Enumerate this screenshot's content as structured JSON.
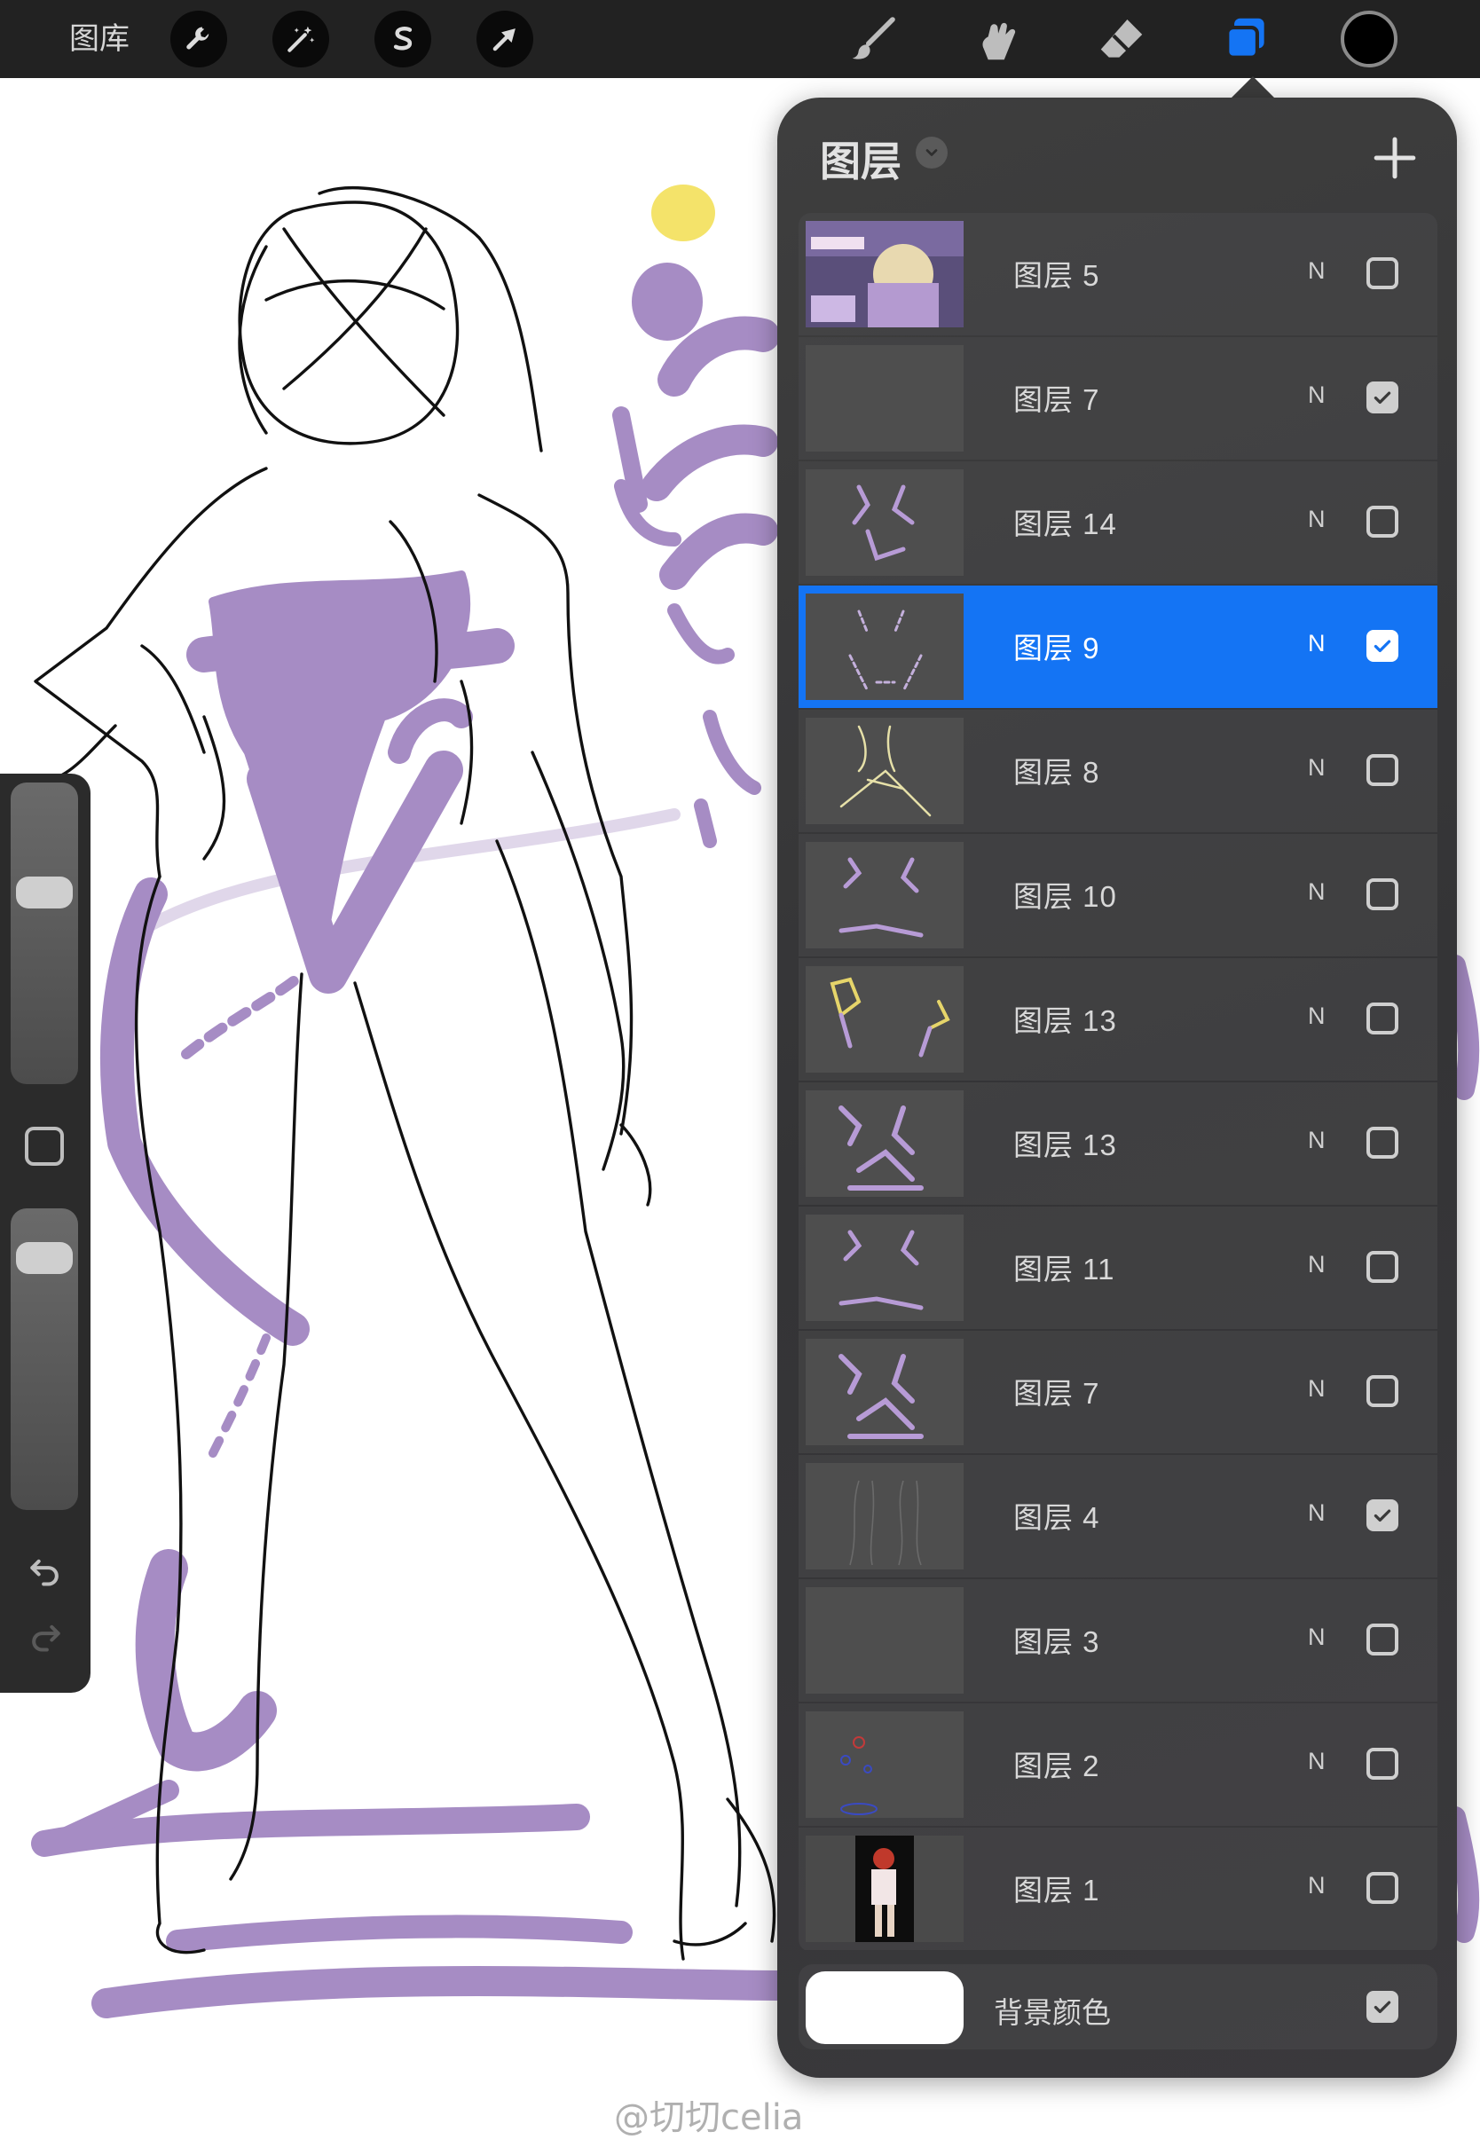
{
  "toolbar": {
    "gallery_label": "图库",
    "actions": [
      {
        "icon": "wrench-icon",
        "name": "actions"
      },
      {
        "icon": "magic-wand-icon",
        "name": "adjustments"
      },
      {
        "icon": "selection-s-icon",
        "name": "selection"
      },
      {
        "icon": "arrow-cursor-icon",
        "name": "transform"
      }
    ],
    "paint_tools": [
      {
        "icon": "brush-icon",
        "name": "paint"
      },
      {
        "icon": "smudge-icon",
        "name": "smudge"
      },
      {
        "icon": "eraser-icon",
        "name": "erase"
      },
      {
        "icon": "layers-icon",
        "name": "layers",
        "active": true
      }
    ],
    "current_color": "#000000",
    "active_accent": "#1474f4"
  },
  "sidebar": {
    "brush_size_level": 0.65,
    "opacity_level": 0.25,
    "modify_icon": "square-modify-icon",
    "undo_icon": "undo-icon",
    "redo_icon": "redo-icon"
  },
  "canvas": {
    "sketch_color": "#111111",
    "paint_color": "#a68cc4",
    "dot_colors": [
      "#f4e36a",
      "#a68cc4"
    ]
  },
  "layers_panel": {
    "title": "图层",
    "add_icon": "plus-icon",
    "chevron_icon": "chevron-down-icon",
    "layers": [
      {
        "name": "图层 5",
        "mode": "N",
        "visible": false,
        "selected": false,
        "thumb": "photo"
      },
      {
        "name": "图层 7",
        "mode": "N",
        "visible": true,
        "selected": false,
        "thumb": "empty"
      },
      {
        "name": "图层 14",
        "mode": "N",
        "visible": false,
        "selected": false,
        "thumb": "purple-sketch"
      },
      {
        "name": "图层 9",
        "mode": "N",
        "visible": true,
        "selected": true,
        "thumb": "purple-outline"
      },
      {
        "name": "图层 8",
        "mode": "N",
        "visible": false,
        "selected": false,
        "thumb": "yellow-lines"
      },
      {
        "name": "图层 10",
        "mode": "N",
        "visible": false,
        "selected": false,
        "thumb": "purple-marks"
      },
      {
        "name": "图层 13",
        "mode": "N",
        "visible": false,
        "selected": false,
        "thumb": "yellow-purple"
      },
      {
        "name": "图层 13",
        "mode": "N",
        "visible": false,
        "selected": false,
        "thumb": "purple-shapes"
      },
      {
        "name": "图层 11",
        "mode": "N",
        "visible": false,
        "selected": false,
        "thumb": "purple-marks"
      },
      {
        "name": "图层 7",
        "mode": "N",
        "visible": false,
        "selected": false,
        "thumb": "purple-shapes"
      },
      {
        "name": "图层 4",
        "mode": "N",
        "visible": true,
        "selected": false,
        "thumb": "figure-lines"
      },
      {
        "name": "图层 3",
        "mode": "N",
        "visible": false,
        "selected": false,
        "thumb": "empty"
      },
      {
        "name": "图层 2",
        "mode": "N",
        "visible": false,
        "selected": false,
        "thumb": "blue-red-circles"
      },
      {
        "name": "图层 1",
        "mode": "N",
        "visible": false,
        "selected": false,
        "thumb": "character-photo"
      }
    ],
    "background": {
      "label": "背景颜色",
      "color": "#ffffff",
      "visible": true
    }
  },
  "watermark": "@切切celia"
}
